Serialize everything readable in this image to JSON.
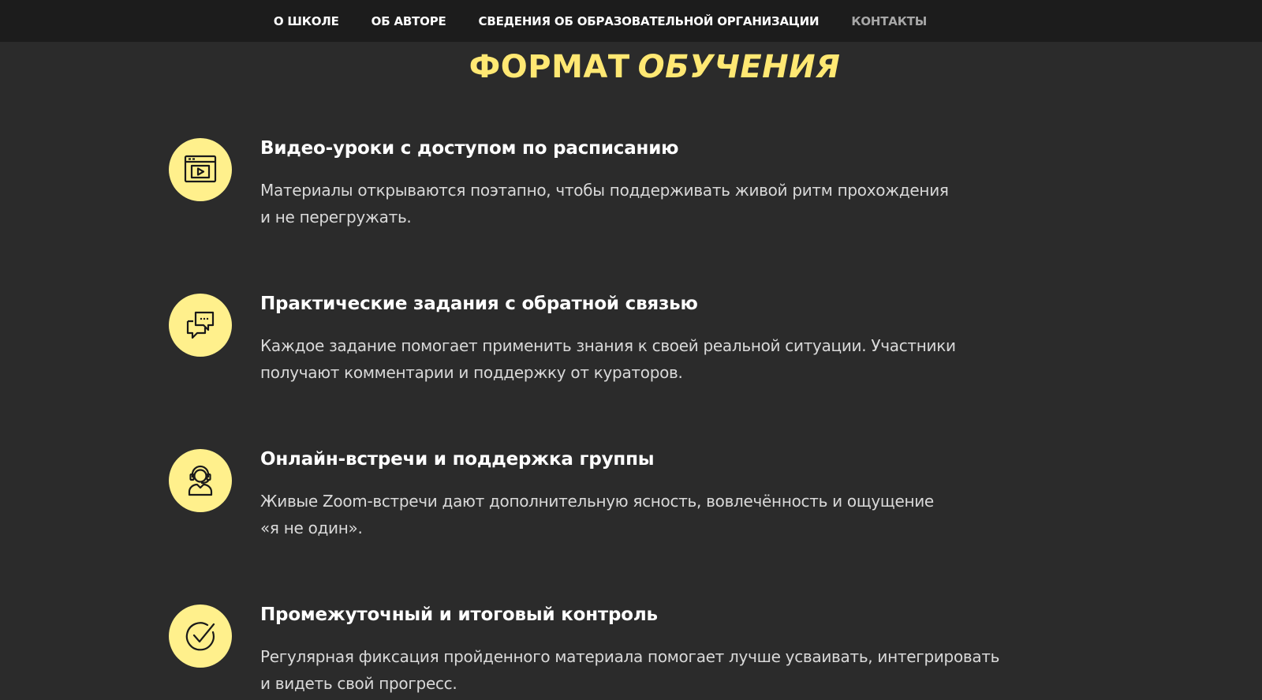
{
  "nav": {
    "items": [
      {
        "label": "О ШКОЛЕ"
      },
      {
        "label": "ОБ АВТОРЕ"
      },
      {
        "label": "СВЕДЕНИЯ ОБ ОБРАЗОВАТЕЛЬНОЙ ОРГАНИЗАЦИИ"
      },
      {
        "label": "КОНТАКТЫ"
      }
    ]
  },
  "section": {
    "title_lead": "ФОРМАТ",
    "title_accent": "ОБУЧЕНИЯ"
  },
  "features": [
    {
      "icon": "video-player-icon",
      "title": "Видео-уроки с доступом по расписанию",
      "desc_line1": "Материалы открываются поэтапно, чтобы поддерживать живой ритм прохождения",
      "desc_line2": "и не перегружать."
    },
    {
      "icon": "chat-feedback-icon",
      "title": "Практические задания с обратной связью",
      "desc_line1": "Каждое задание помогает применить знания к своей реальной ситуации. Участники",
      "desc_line2": "получают комментарии и поддержку от кураторов."
    },
    {
      "icon": "support-agent-icon",
      "title": "Онлайн-встречи и поддержка группы",
      "desc_line1": "Живые Zoom-встречи дают дополнительную ясность, вовлечённость и ощущение",
      "desc_line2": "«я не один»."
    },
    {
      "icon": "check-circle-icon",
      "title": "Промежуточный и итоговый контроль",
      "desc_line1": "Регулярная фиксация пройденного материала помогает лучше усваивать, интегрировать",
      "desc_line2": "и видеть свой прогресс."
    }
  ],
  "colors": {
    "background": "#2b2b2b",
    "nav_background": "#1c1c1c",
    "accent_yellow": "#ffe873",
    "icon_circle": "#fff08c"
  }
}
